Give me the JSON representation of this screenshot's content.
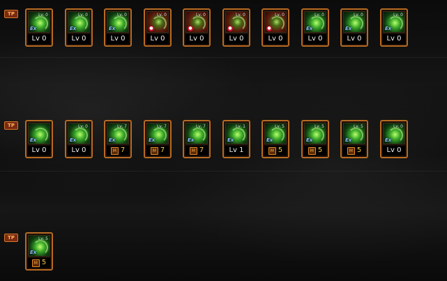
{
  "rows": [
    {
      "tag": "TP",
      "skills": [
        {
          "level": "Lv. 0",
          "badge": "Ex",
          "value": "Lv 0",
          "style": "green"
        },
        {
          "level": "Lv. 0",
          "badge": "Ex",
          "value": "Lv 0",
          "style": "green"
        },
        {
          "level": "Lv. 0",
          "badge": "Ex",
          "value": "Lv 0",
          "style": "green"
        },
        {
          "level": "Lv. 0",
          "badge": "lock",
          "value": "Lv 0",
          "style": "red"
        },
        {
          "level": "Lv. 0",
          "badge": "lock",
          "value": "Lv 0",
          "style": "red"
        },
        {
          "level": "Lv. 0",
          "badge": "lock",
          "value": "Lv 0",
          "style": "red"
        },
        {
          "level": "Lv. 0",
          "badge": "lock",
          "value": "Lv 0",
          "style": "red"
        },
        {
          "level": "Lv. 0",
          "badge": "Ex",
          "value": "Lv 0",
          "style": "green"
        },
        {
          "level": "Lv. 0",
          "badge": "Ex",
          "value": "Lv 0",
          "style": "green"
        },
        {
          "level": "Lv. 0",
          "badge": "Ex",
          "value": "Lv 0",
          "style": "green"
        }
      ]
    },
    {
      "tag": "TP",
      "skills": [
        {
          "level": "",
          "badge": "Ex",
          "value": "Lv 0",
          "style": "green"
        },
        {
          "level": "Lv. 0",
          "badge": "Ex",
          "value": "Lv 0",
          "style": "green"
        },
        {
          "level": "Lv. 7",
          "badge": "Ex",
          "value": "7",
          "mastery": "M",
          "style": "green"
        },
        {
          "level": "Lv. 7",
          "badge": "Ex",
          "value": "7",
          "mastery": "M",
          "style": "green"
        },
        {
          "level": "Lv. 7",
          "badge": "Ex",
          "value": "7",
          "mastery": "M",
          "style": "green"
        },
        {
          "level": "Lv. 1",
          "badge": "Ex",
          "value": "Lv 1",
          "style": "green"
        },
        {
          "level": "Lv. 5",
          "badge": "Ex",
          "value": "5",
          "mastery": "M",
          "style": "green"
        },
        {
          "level": "Lv. 5",
          "badge": "Ex",
          "value": "5",
          "mastery": "M",
          "style": "green"
        },
        {
          "level": "Lv. 5",
          "badge": "Ex",
          "value": "5",
          "mastery": "M",
          "style": "green"
        },
        {
          "level": "Lv. 0",
          "badge": "Ex",
          "value": "Lv 0",
          "style": "green"
        }
      ]
    },
    {
      "tag": "TP",
      "skills": [
        {
          "level": "Lv. 5",
          "badge": "Ex",
          "value": "5",
          "mastery": "M",
          "style": "green"
        }
      ]
    }
  ]
}
